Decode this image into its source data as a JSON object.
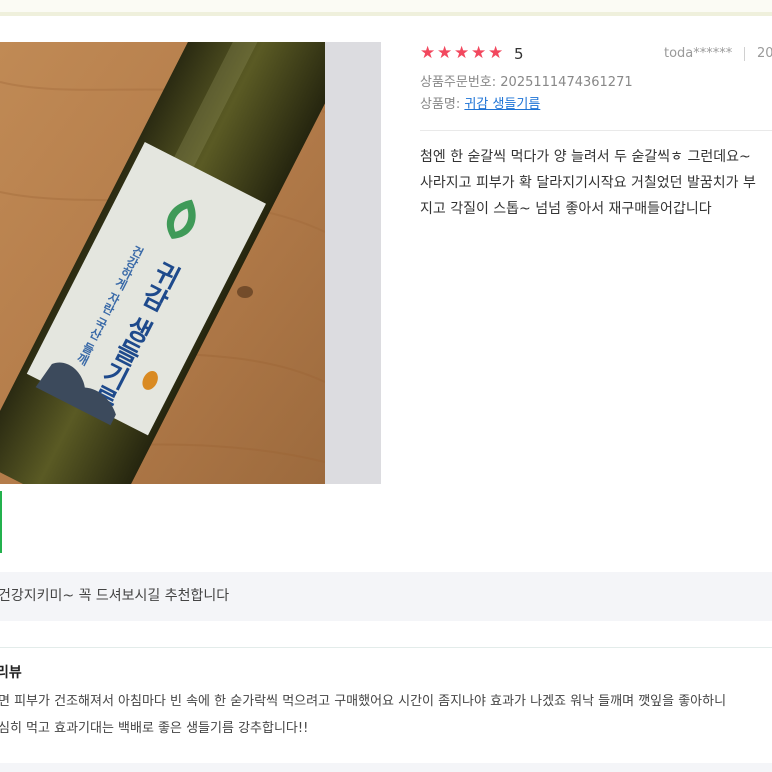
{
  "review": {
    "rating_stars": 5,
    "rating_value": "5",
    "author": "toda******",
    "date": "20",
    "order_label": "상품주문번호: 2025111474361271",
    "product_prefix": "상품명: ",
    "product_name": "귀감 생들기름",
    "body_lines": [
      "첨엔 한 숟갈씩 먹다가 양 늘려서 두 숟갈씩ㅎ 그런데요~",
      "사라지고 피부가 확 달라지기시작요 거칠었던 발꿈치가 부",
      "지고 각질이 스톱~ 넘넘 좋아서 재구매들어갑니다"
    ]
  },
  "photo": {
    "label_brand": "귀감 생들기름",
    "label_sub": "건강하게 자란 국산 들깨"
  },
  "qa_text": "건강지키미~ 꼭 드셔보시길 추천합니다",
  "section": {
    "title": "리뷰",
    "lines": [
      "면 피부가 건조해져서 아침마다 빈 속에 한 숟가락씩 먹으려고 구매했어요 시간이 좀지나야 효과가 나겠죠 워낙 들깨며 깻잎을 좋아하니",
      "심히 먹고 효과기대는 백배로 좋은 생들기름 강추합니다!!"
    ]
  },
  "colors": {
    "star": "#f2485e",
    "link": "#1d73d6",
    "accent_green": "#23b14d"
  }
}
